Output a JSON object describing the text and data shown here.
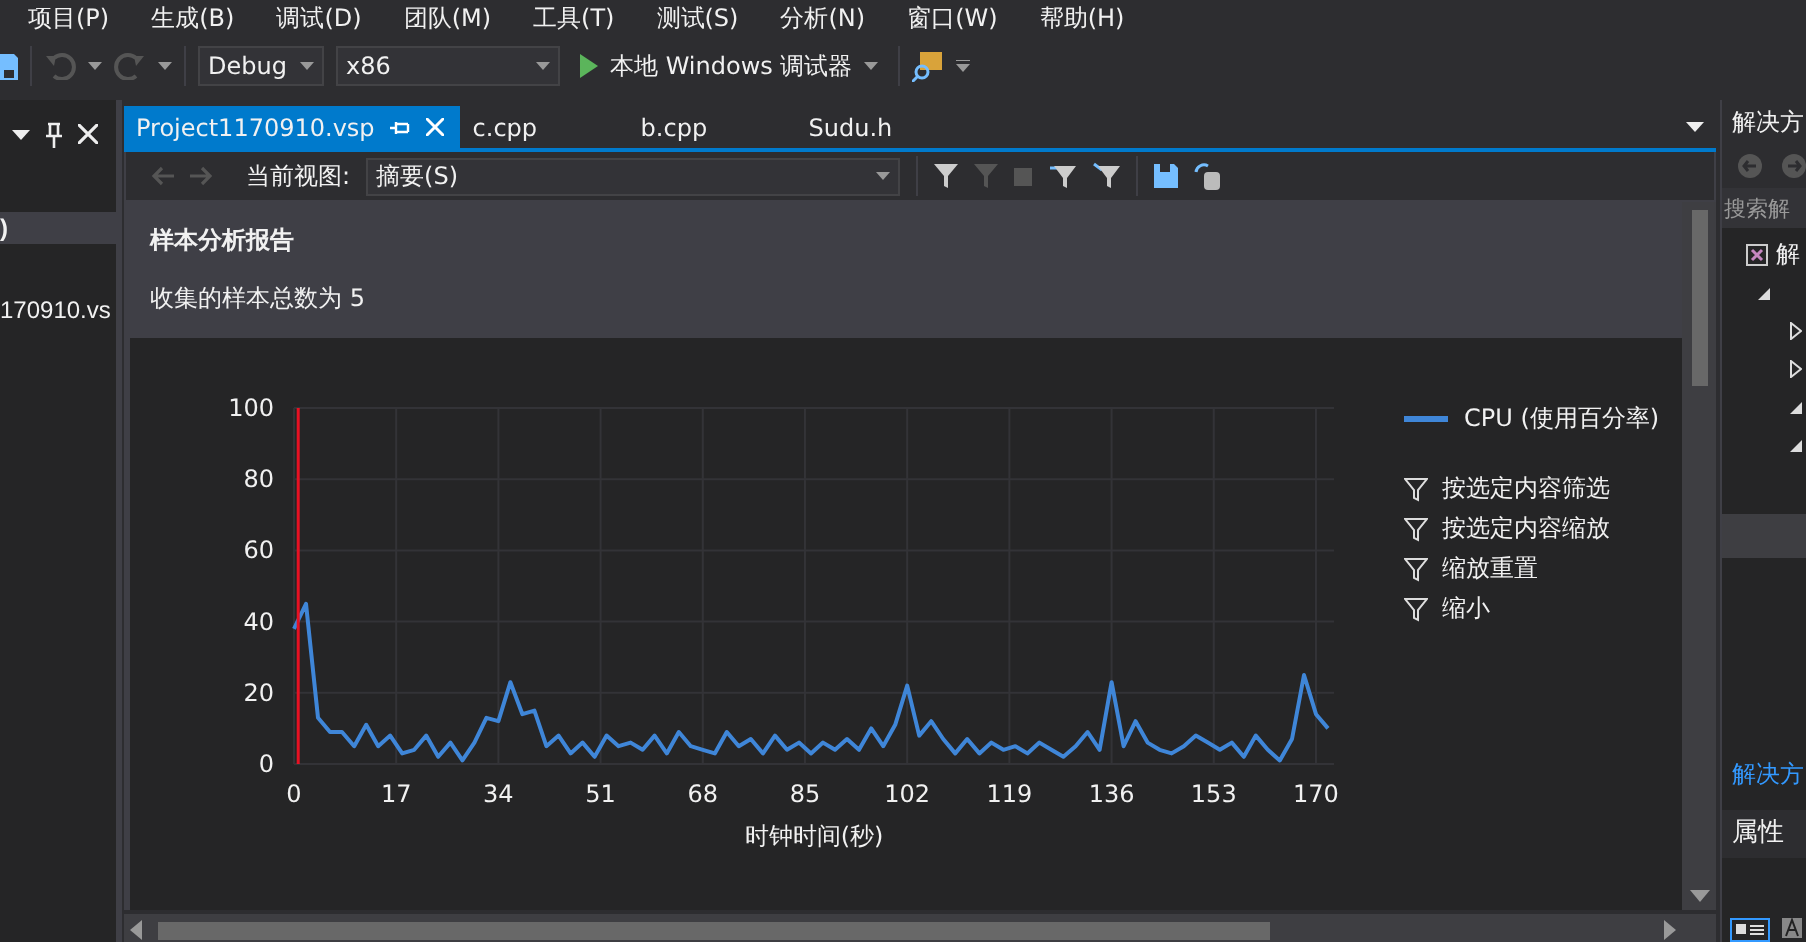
{
  "menu": [
    "项目(P)",
    "生成(B)",
    "调试(D)",
    "团队(M)",
    "工具(T)",
    "测试(S)",
    "分析(N)",
    "窗口(W)",
    "帮助(H)"
  ],
  "toolbar": {
    "configuration": "Debug",
    "platform": "x86",
    "start_button": "本地 Windows 调试器"
  },
  "left_panel": {
    "items": [
      {
        "label": ")",
        "selected": true
      },
      {
        "label": "170910.vs",
        "selected": false
      }
    ]
  },
  "tabs": [
    {
      "label": "Project1170910.vsp",
      "selected": true
    },
    {
      "label": "c.cpp",
      "selected": false
    },
    {
      "label": "b.cpp",
      "selected": false
    },
    {
      "label": "Sudu.h",
      "selected": false
    }
  ],
  "view_toolbar": {
    "label": "当前视图:",
    "view": "摘要(S)"
  },
  "report": {
    "title": "样本分析报告",
    "summary": "收集的样本总数为 5"
  },
  "chart": {
    "chart_data": {
      "type": "line",
      "grid": true,
      "xlabel": "时钟时间(秒)",
      "xlim": [
        0,
        173
      ],
      "ylim": [
        0,
        100
      ],
      "xticks": [
        0,
        17,
        34,
        51,
        68,
        85,
        102,
        119,
        136,
        153,
        170
      ],
      "yticks": [
        0,
        20,
        40,
        60,
        80,
        100
      ],
      "x": [
        0,
        2,
        4,
        6,
        8,
        10,
        12,
        14,
        16,
        18,
        20,
        22,
        24,
        26,
        28,
        30,
        32,
        34,
        36,
        38,
        40,
        42,
        44,
        46,
        48,
        50,
        52,
        54,
        56,
        58,
        60,
        62,
        64,
        66,
        68,
        70,
        72,
        74,
        76,
        78,
        80,
        82,
        84,
        86,
        88,
        90,
        92,
        94,
        96,
        98,
        100,
        102,
        104,
        106,
        108,
        110,
        112,
        114,
        116,
        118,
        120,
        122,
        124,
        126,
        128,
        130,
        132,
        134,
        136,
        138,
        140,
        142,
        144,
        146,
        148,
        150,
        152,
        154,
        156,
        158,
        160,
        162,
        164,
        166,
        168,
        170,
        172
      ],
      "series": [
        {
          "name": "CPU (使用百分率)",
          "color": "#3f86d8",
          "values": [
            38,
            45,
            13,
            9,
            9,
            5,
            11,
            5,
            8,
            3,
            4,
            8,
            2,
            6,
            1,
            6,
            13,
            12,
            23,
            14,
            15,
            5,
            8,
            3,
            6,
            2,
            8,
            5,
            6,
            4,
            8,
            3,
            9,
            5,
            4,
            3,
            9,
            5,
            7,
            3,
            8,
            4,
            6,
            3,
            6,
            4,
            7,
            4,
            10,
            5,
            11,
            22,
            8,
            12,
            7,
            3,
            7,
            3,
            6,
            4,
            5,
            3,
            6,
            4,
            2,
            5,
            9,
            4,
            23,
            5,
            12,
            6,
            4,
            3,
            5,
            8,
            6,
            4,
            6,
            2,
            8,
            4,
            1,
            7,
            25,
            14,
            10
          ]
        }
      ]
    },
    "actions": [
      "按选定内容筛选",
      "按选定内容缩放",
      "缩放重置",
      "缩小"
    ]
  },
  "right_panel": {
    "title": "解决方",
    "search_placeholder": "搜索解",
    "tree": [
      {
        "label": "解",
        "children": [
          {
            "expanded": true,
            "children": [
              {
                "expanded": false
              },
              {
                "expanded": false
              },
              {
                "expanded": true
              },
              {
                "expanded": true
              }
            ]
          }
        ]
      }
    ],
    "explorer_tab": {
      "label": "解决方",
      "selected": true
    },
    "properties": {
      "title": "属性"
    }
  }
}
